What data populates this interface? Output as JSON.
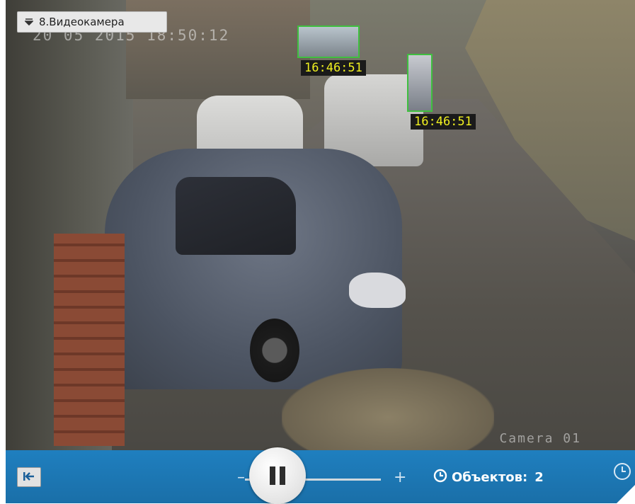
{
  "camera_selector": {
    "label": "8.Видеокамера",
    "icon": "chevron-down-icon"
  },
  "overlay": {
    "timestamp": "20 05 2015 18:50:12",
    "camera_name": "Camera 01"
  },
  "detections": [
    {
      "time": "16:46:51"
    },
    {
      "time": "16:46:51"
    }
  ],
  "controls": {
    "back_icon": "skip-to-start-icon",
    "minus_label": "–",
    "plus_label": "+",
    "pause_icon": "pause-icon",
    "objects_label": "Объектов:",
    "objects_count": "2",
    "objects_icon": "clock-icon",
    "corner_icon": "clock-icon"
  },
  "colors": {
    "control_bar": "#1f7fbf",
    "detection_box": "#3fbf3f",
    "detection_text": "#f0f020"
  }
}
